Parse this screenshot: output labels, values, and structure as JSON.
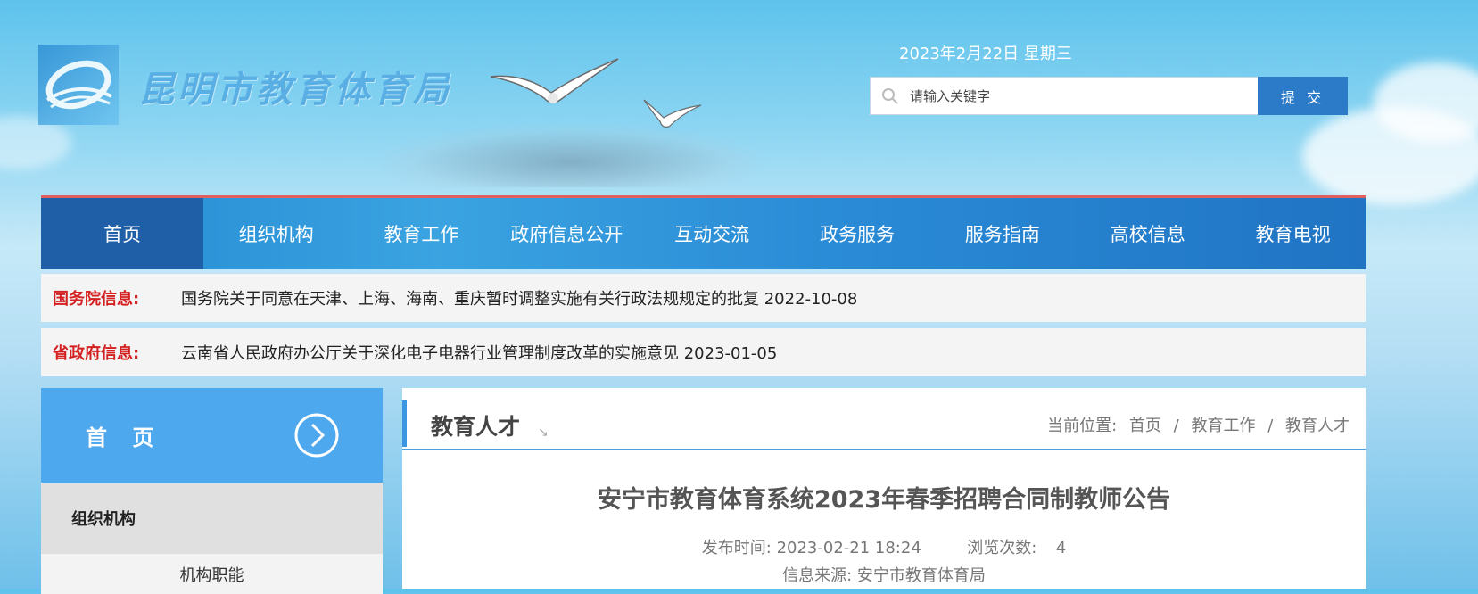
{
  "header": {
    "site_name": "昆明市教育体育局",
    "date": "2023年2月22日 星期三",
    "search": {
      "placeholder": "请输入关键字",
      "button": "提 交"
    }
  },
  "nav": [
    {
      "label": "首页",
      "active": true
    },
    {
      "label": "组织机构"
    },
    {
      "label": "教育工作"
    },
    {
      "label": "政府信息公开"
    },
    {
      "label": "互动交流"
    },
    {
      "label": "政务服务"
    },
    {
      "label": "服务指南"
    },
    {
      "label": "高校信息"
    },
    {
      "label": "教育电视"
    }
  ],
  "tickers": [
    {
      "label": "国务院信息:",
      "text": "国务院关于同意在天津、上海、海南、重庆暂时调整实施有关行政法规规定的批复 2022-10-08"
    },
    {
      "label": "省政府信息:",
      "text": "云南省人民政府办公厅关于深化电子电器行业管理制度改革的实施意见 2023-01-05"
    }
  ],
  "sidebar": {
    "head": "首 页",
    "group": "组织机构",
    "sub": "机构职能"
  },
  "main": {
    "section_title": "教育人才",
    "breadcrumb": {
      "prefix": "当前位置:",
      "items": [
        "首页",
        "教育工作",
        "教育人才"
      ],
      "sep": "/"
    },
    "article_title": "安宁市教育体育系统2023年春季招聘合同制教师公告",
    "publish_label": "发布时间:",
    "publish_time": "2023-02-21 18:24",
    "views_label": "浏览次数:",
    "views": "4",
    "source_label": "信息来源:",
    "source": "安宁市教育体育局"
  }
}
